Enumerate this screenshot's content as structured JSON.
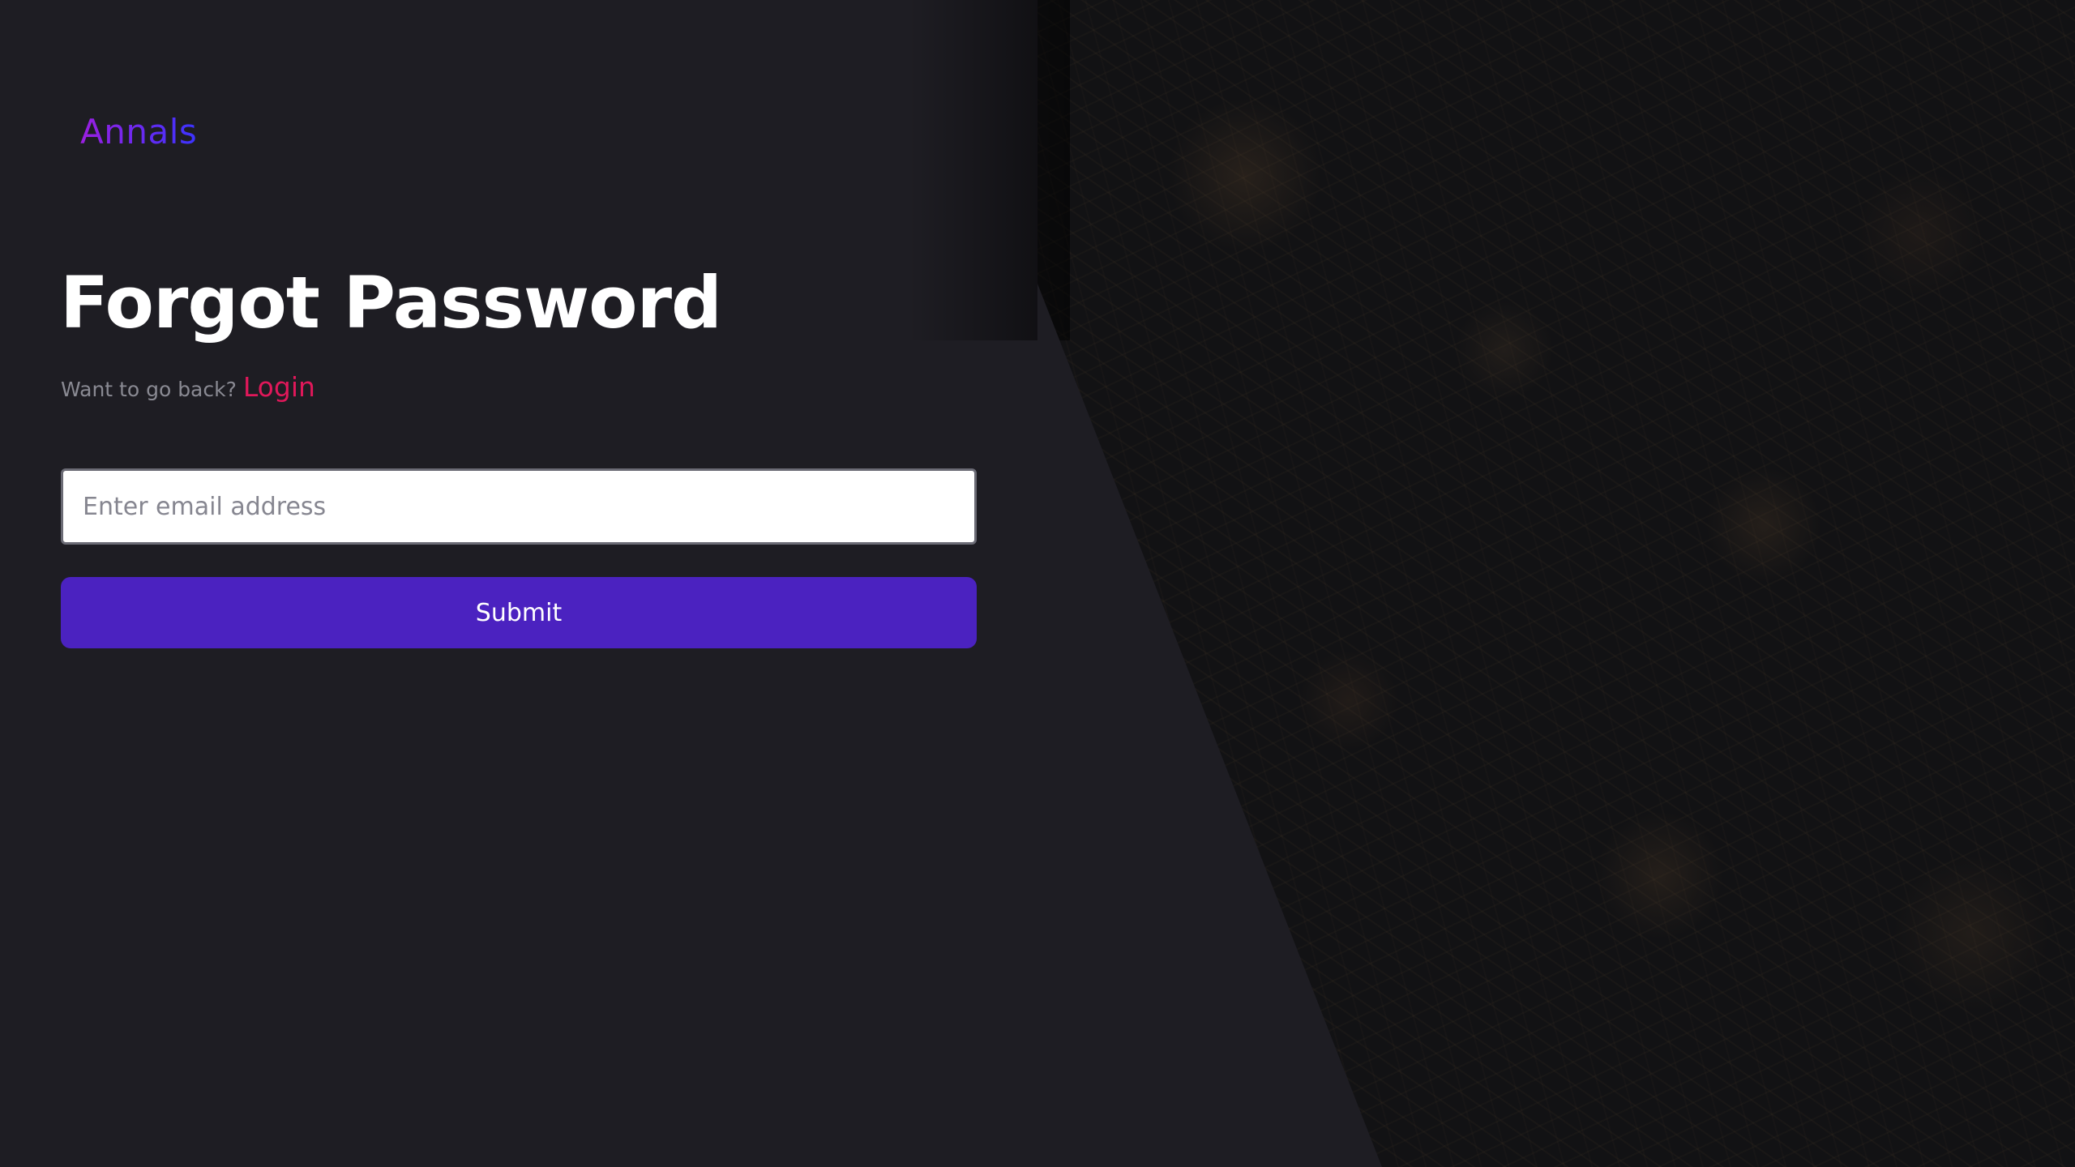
{
  "brand": {
    "logo_text": "Annals"
  },
  "form": {
    "title": "Forgot Password",
    "back_prompt": "Want to go back?",
    "login_link": "Login",
    "email_placeholder": "Enter email address",
    "email_value": "",
    "submit_label": "Submit"
  },
  "colors": {
    "background": "#1e1d23",
    "logo_gradient_start": "#9b1fe0",
    "logo_gradient_end": "#3b33ff",
    "link": "#e0185a",
    "submit_button": "#4b22c0"
  },
  "background_image": "dark forest floor with pine cones and pine needles"
}
